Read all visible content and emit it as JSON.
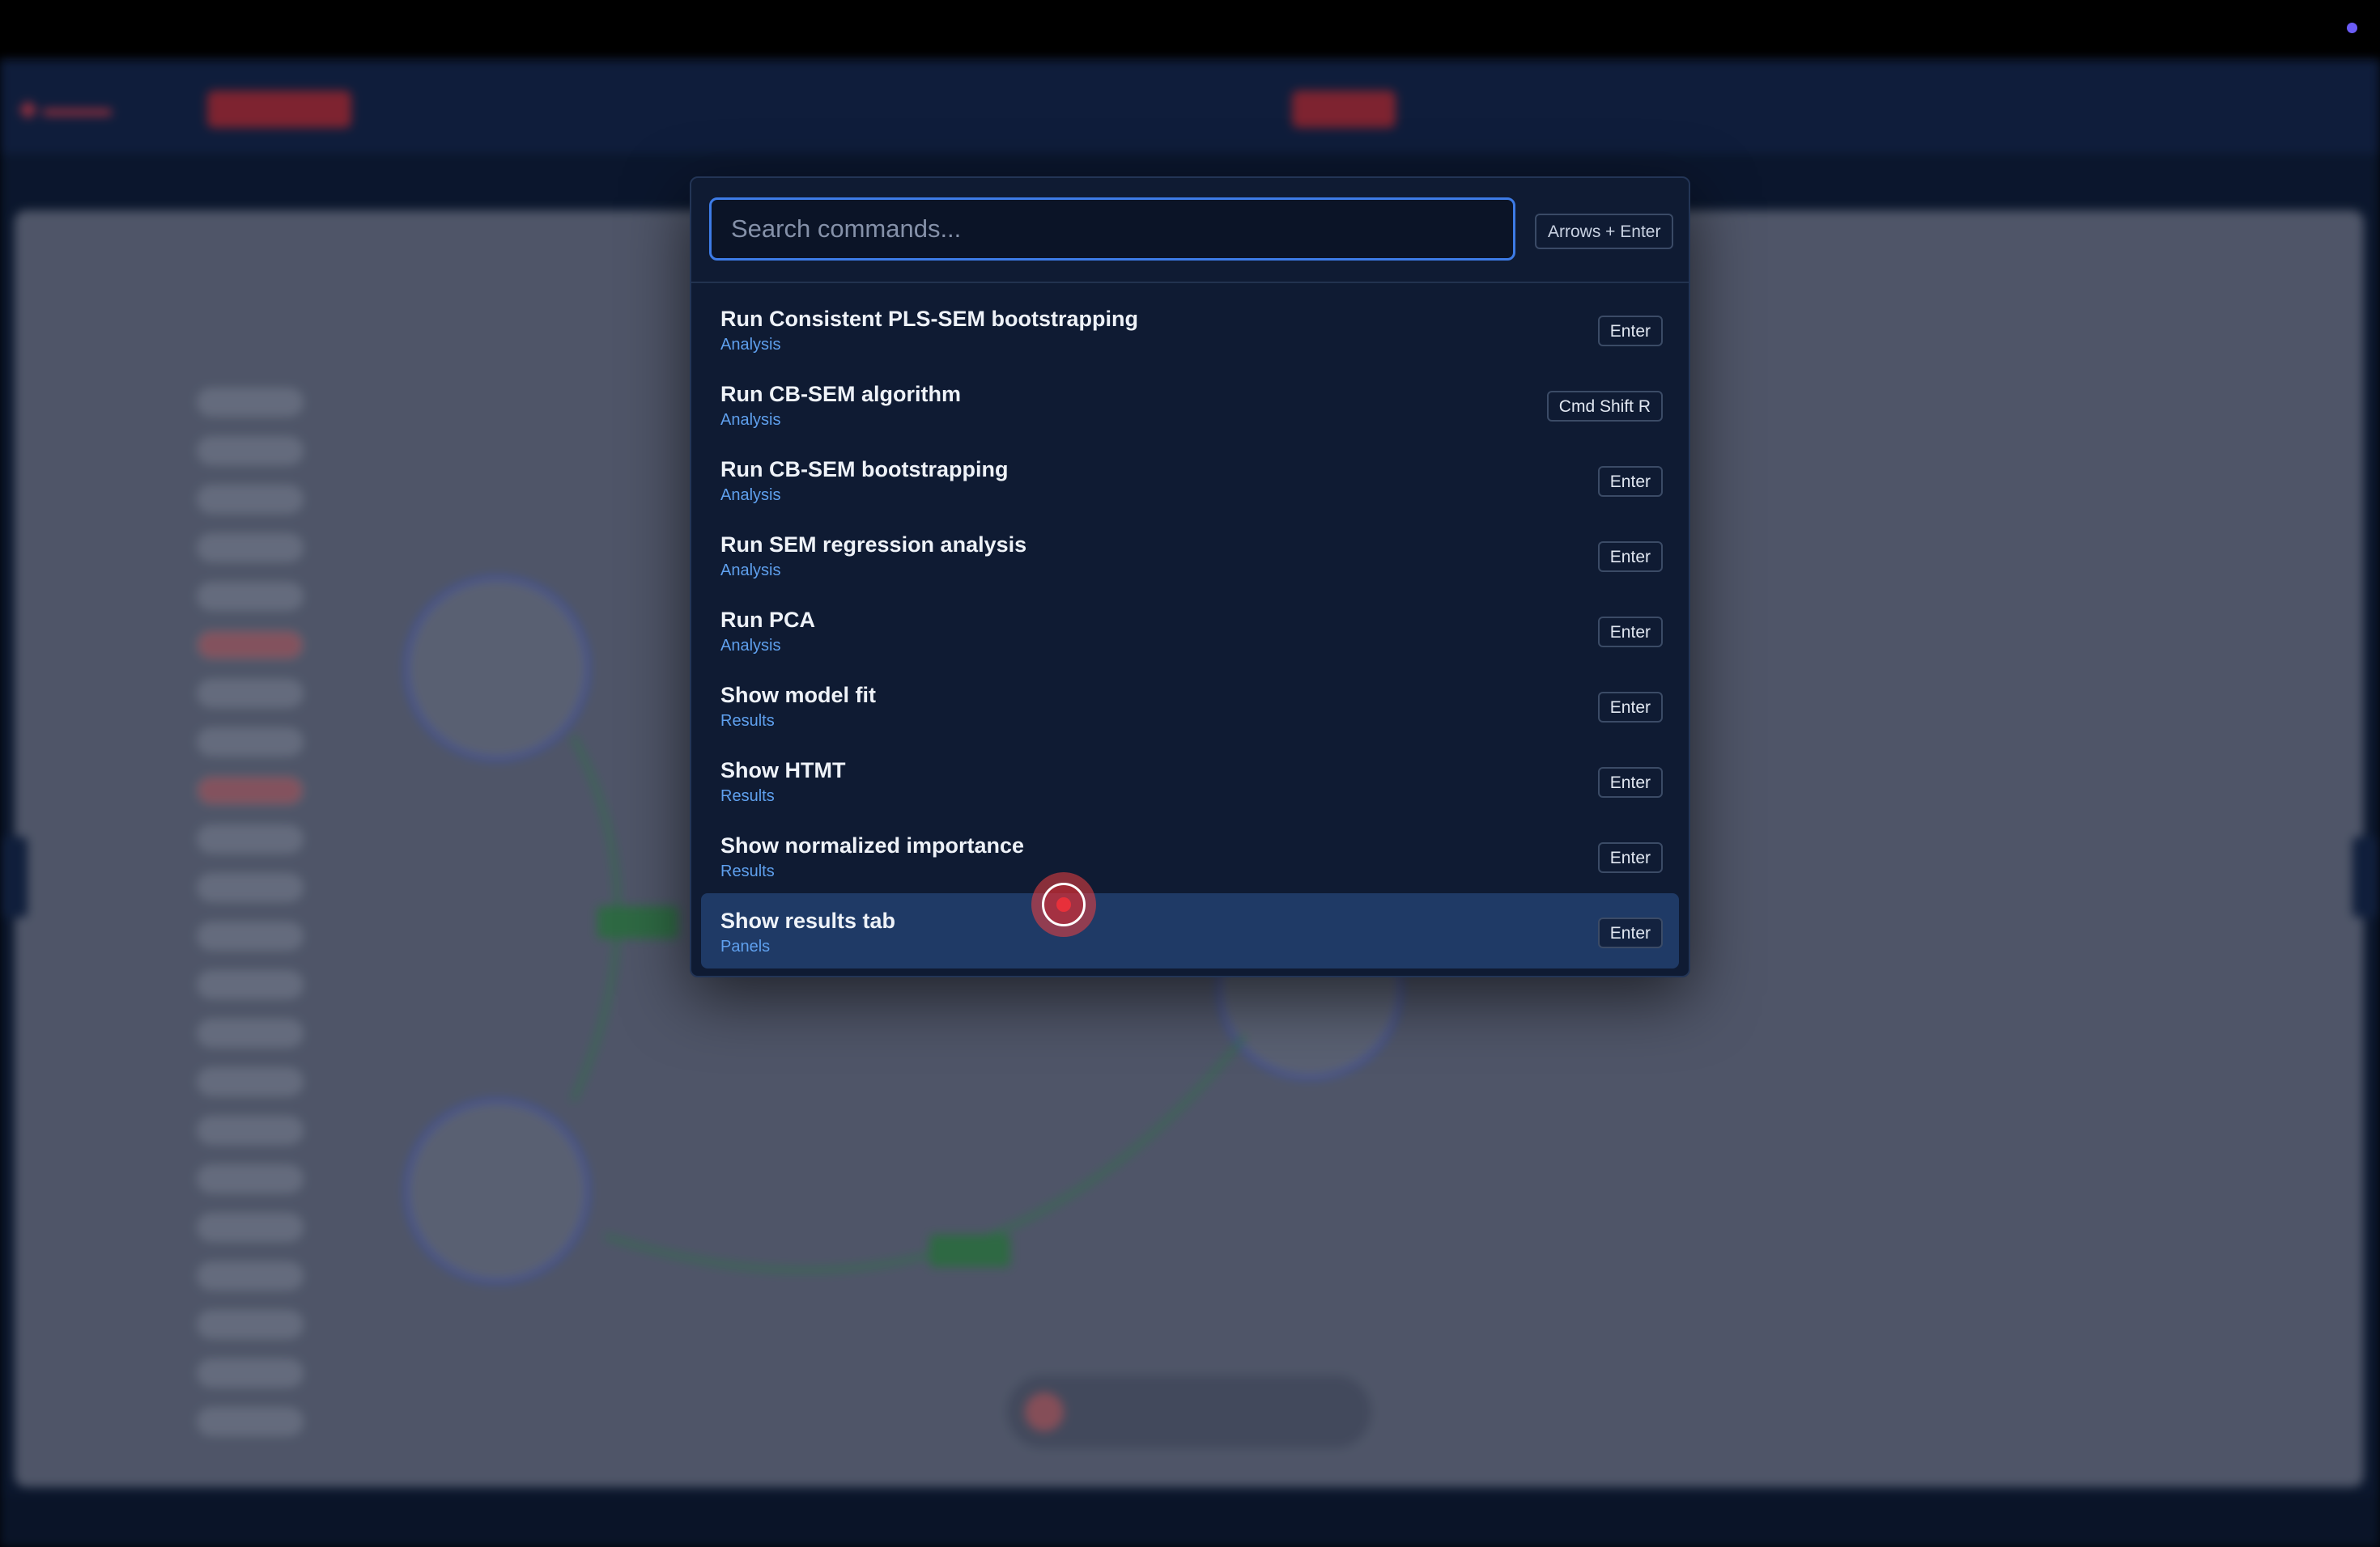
{
  "palette": {
    "search_placeholder": "Search commands...",
    "hint": "Arrows + Enter",
    "items": [
      {
        "title": "Run Consistent PLS-SEM bootstrapping",
        "category": "Analysis",
        "shortcut": "Enter"
      },
      {
        "title": "Run CB-SEM algorithm",
        "category": "Analysis",
        "shortcut": "Cmd Shift R"
      },
      {
        "title": "Run CB-SEM bootstrapping",
        "category": "Analysis",
        "shortcut": "Enter"
      },
      {
        "title": "Run SEM regression analysis",
        "category": "Analysis",
        "shortcut": "Enter"
      },
      {
        "title": "Run PCA",
        "category": "Analysis",
        "shortcut": "Enter"
      },
      {
        "title": "Show model fit",
        "category": "Results",
        "shortcut": "Enter"
      },
      {
        "title": "Show HTMT",
        "category": "Results",
        "shortcut": "Enter"
      },
      {
        "title": "Show normalized importance",
        "category": "Results",
        "shortcut": "Enter"
      },
      {
        "title": "Show results tab",
        "category": "Panels",
        "shortcut": "Enter"
      }
    ],
    "active_index": 8
  },
  "colors": {
    "accent": "#3d7be6",
    "category_text": "#5fa0ee",
    "active_row": "#1f3a66",
    "panel_bg": "#0f1b33",
    "cursor": "#e8303a"
  }
}
